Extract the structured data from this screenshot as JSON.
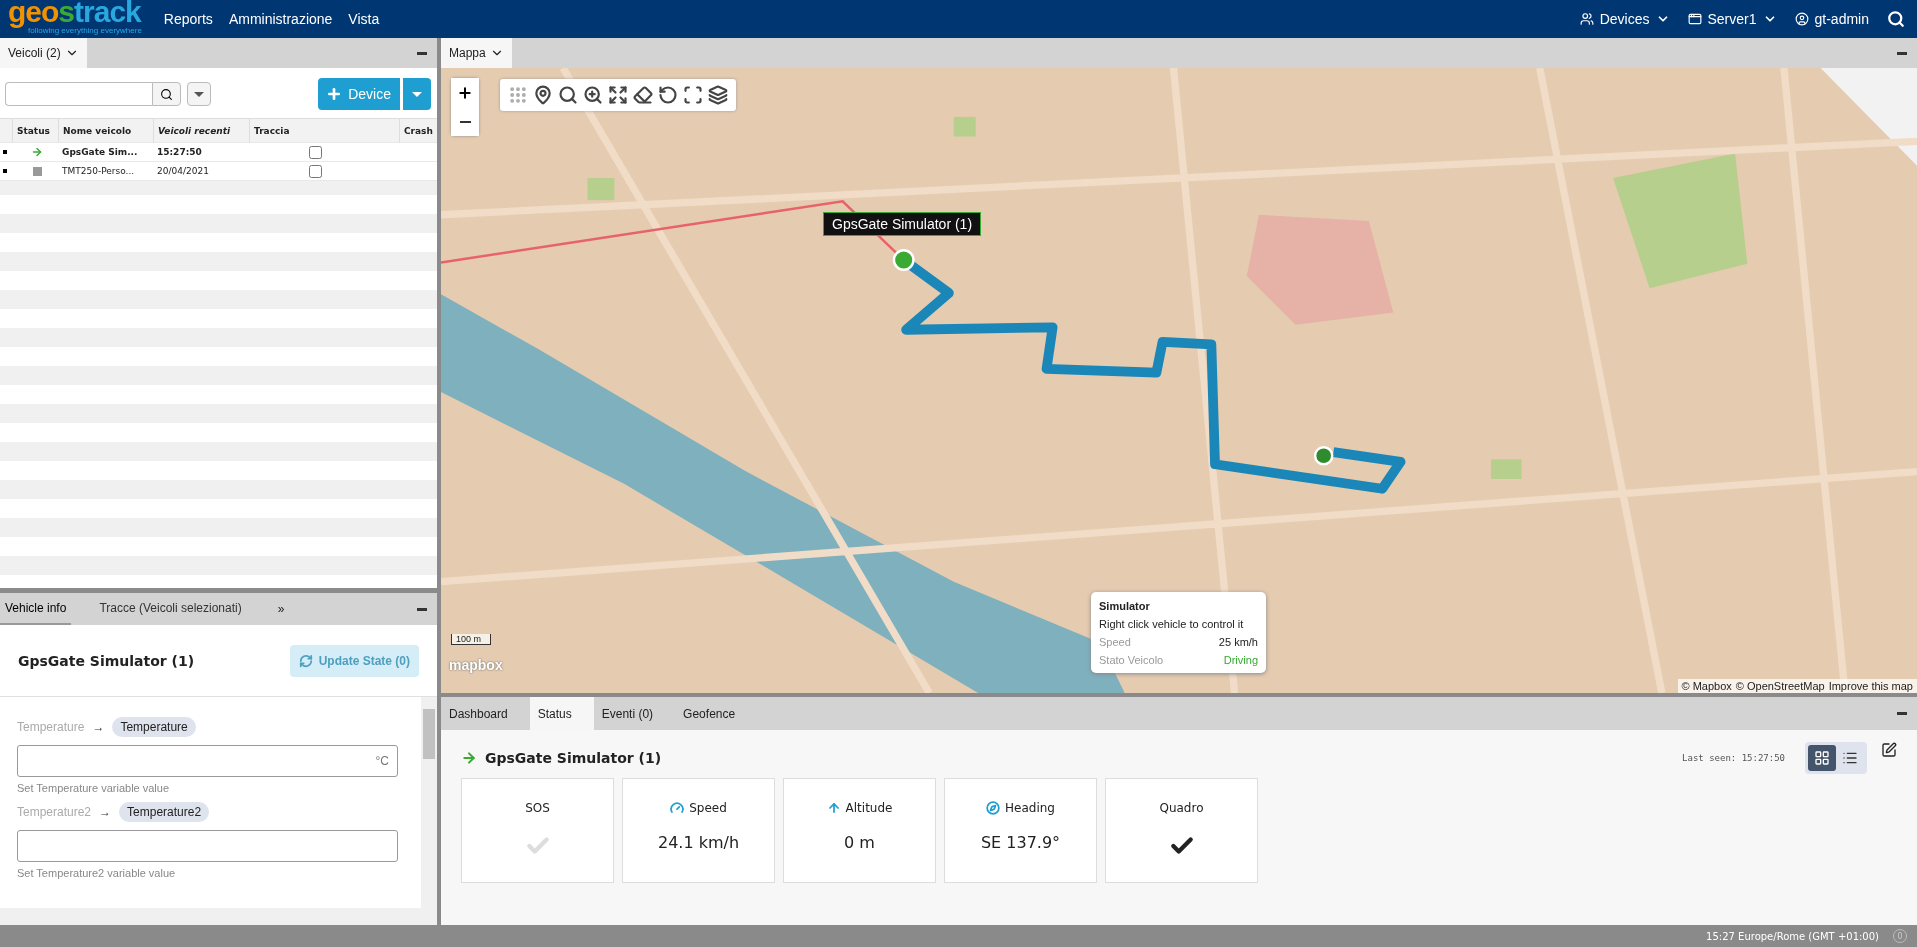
{
  "header": {
    "logo": {
      "parts": [
        {
          "text": "geo",
          "color": "#f39200"
        },
        {
          "text": "s",
          "color": "#3aaa35"
        },
        {
          "text": "track",
          "color": "#29a8e0"
        }
      ],
      "tagline": "following everything everywhere"
    },
    "menu": [
      "Reports",
      "Amministrazione",
      "Vista"
    ],
    "right_menu": [
      {
        "label": "Devices",
        "dropdown": true
      },
      {
        "label": "Server1",
        "dropdown": true
      },
      {
        "label": "gt-admin",
        "dropdown": false
      }
    ]
  },
  "vehicles_panel": {
    "tab": "Veicoli (2)",
    "add_button": "Device",
    "columns": [
      {
        "label": "Status",
        "italic": false
      },
      {
        "label": "Nome veicolo",
        "italic": false
      },
      {
        "label": "Veicoli recenti",
        "italic": true
      },
      {
        "label": "Traccia",
        "italic": false
      },
      {
        "label": "Crash",
        "italic": false
      }
    ],
    "rows": [
      {
        "kind": "moving",
        "name": "GpsGate Sim...",
        "recent": "15:27:50",
        "traccia": false,
        "selected": true
      },
      {
        "kind": "offline",
        "name": "TMT250-Perso...",
        "recent": "20/04/2021",
        "traccia": false,
        "selected": false
      }
    ]
  },
  "info_panel": {
    "tabs": [
      {
        "label": "Vehicle info",
        "selected": true
      },
      {
        "label": "Tracce (Veicoli selezionati)",
        "selected": false
      }
    ],
    "more": "»",
    "title": "GpsGate Simulator (1)",
    "update_button": {
      "label": "Update State (0)",
      "disabled": true
    },
    "fields": [
      {
        "label": "Temperature",
        "arrow": "→",
        "variable": "Temperature",
        "unit": "°C",
        "help": "Set Temperature variable value"
      },
      {
        "label": "Temperature2",
        "arrow": "→",
        "variable": "Temperature2",
        "help": "Set Temperature2 variable value"
      }
    ]
  },
  "map_panel": {
    "tab": "Mappa",
    "vehicle_label": "GpsGate Simulator (1)",
    "popup": {
      "title": "Simulator",
      "hint": "Right click vehicle to control it",
      "rows": [
        {
          "label": "Speed",
          "value": "25 km/h",
          "color": "#222222"
        },
        {
          "label": "Stato Veicolo",
          "value": "Driving",
          "color": "#3aaa35"
        }
      ]
    },
    "scale": "100 m",
    "brand": "mapbox",
    "attribution": [
      "© Mapbox",
      "© OpenStreetMap",
      "Improve this map"
    ]
  },
  "status_panel": {
    "tabs": [
      {
        "label": "Dashboard",
        "selected": false
      },
      {
        "label": "Status",
        "selected": true
      },
      {
        "label": "Eventi (0)",
        "selected": false
      },
      {
        "label": "Geofence",
        "selected": false
      }
    ],
    "title": "GpsGate Simulator (1)",
    "last_seen": "Last seen: 15:27:50",
    "views": [
      {
        "selected": true
      },
      {
        "selected": false
      }
    ],
    "cards": [
      {
        "kind": "check",
        "title": "SOS",
        "on": false
      },
      {
        "kind": "value",
        "title": "Speed",
        "value": "24.1 km/h"
      },
      {
        "kind": "value",
        "title": "Altitude",
        "value": "0 m"
      },
      {
        "kind": "value",
        "title": "Heading",
        "value": "SE 137.9°"
      },
      {
        "kind": "check",
        "title": "Quadro",
        "on": true
      }
    ]
  },
  "status_bar": {
    "time": "15:27 Europe/Rome (GMT +01:00)",
    "badge": "0"
  }
}
